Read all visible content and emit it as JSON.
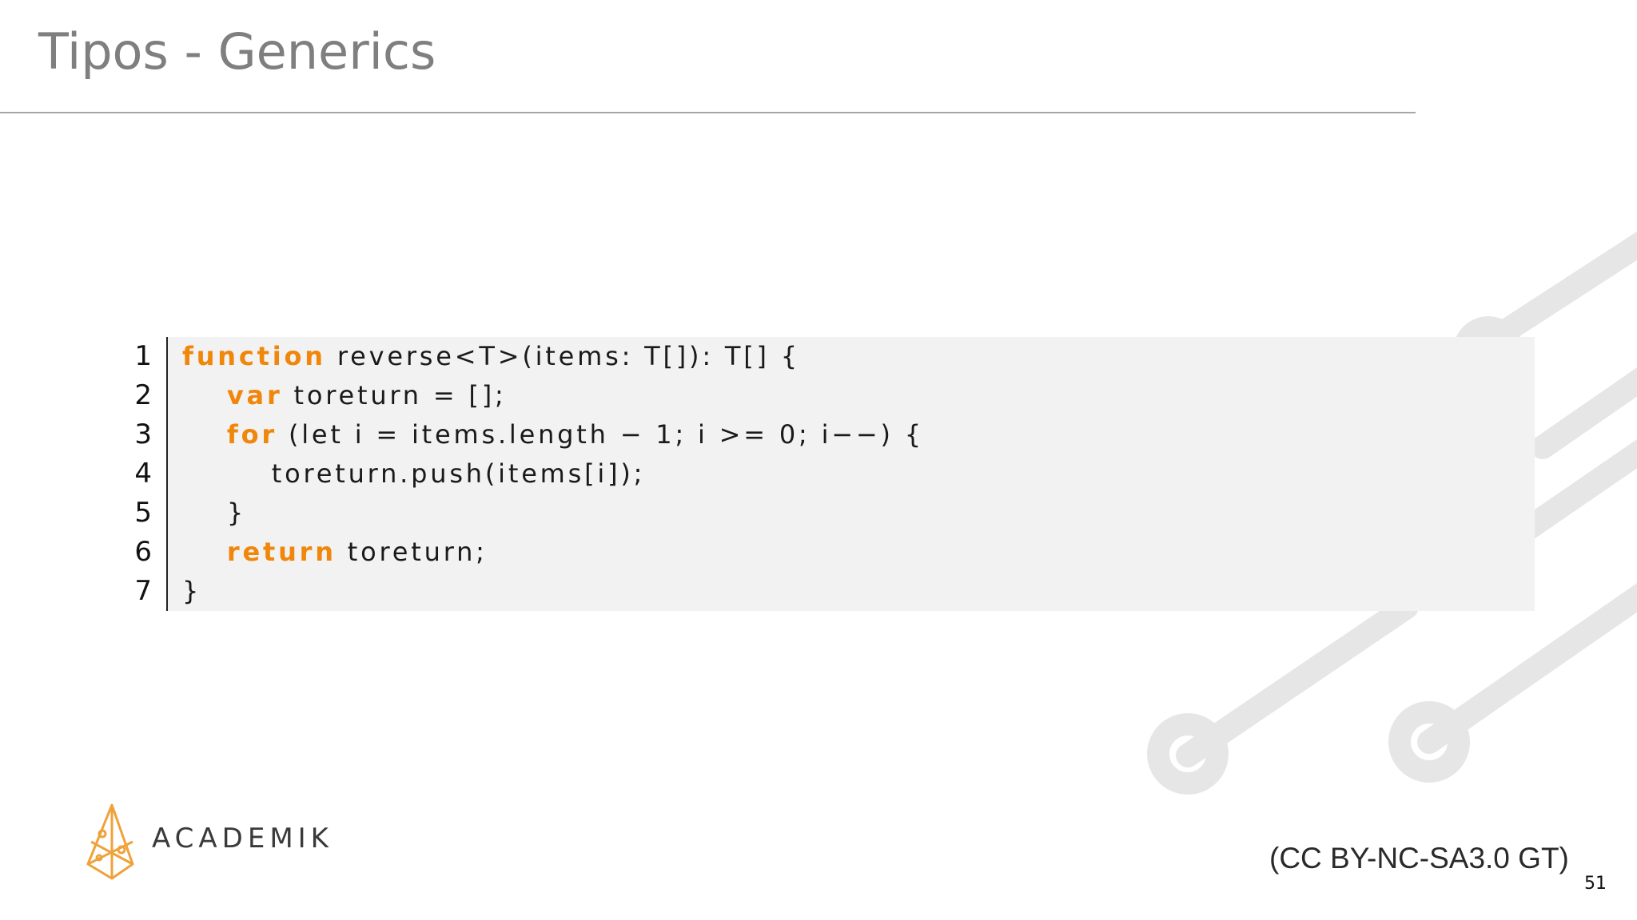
{
  "slide": {
    "title": "Tipos - Generics",
    "page_number": "51",
    "license": "(CC BY-NC-SA3.0 GT)",
    "logo_text": "ACADEMIK",
    "accent_color": "#f0860a"
  },
  "code": {
    "line_numbers": [
      "1",
      "2",
      "3",
      "4",
      "5",
      "6",
      "7"
    ],
    "lines": [
      {
        "indent": "",
        "keyword": "function",
        "rest": " reverse<T>(items: T[]): T[] {"
      },
      {
        "indent": "    ",
        "keyword": "var",
        "rest": " toreturn = [];"
      },
      {
        "indent": "    ",
        "keyword": "for",
        "rest": " (let i = items.length − 1; i >= 0; i−−) {"
      },
      {
        "indent": "        ",
        "keyword": "",
        "rest": "toreturn.push(items[i]);"
      },
      {
        "indent": "    ",
        "keyword": "",
        "rest": "}"
      },
      {
        "indent": "    ",
        "keyword": "return",
        "rest": " toreturn;"
      },
      {
        "indent": "",
        "keyword": "",
        "rest": "}"
      }
    ]
  }
}
